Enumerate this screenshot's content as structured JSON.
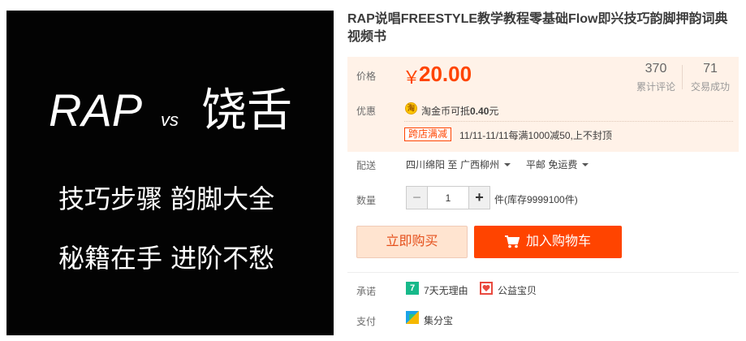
{
  "product_image": {
    "line1_left": "RAP",
    "line1_mid": "vs",
    "line1_right": "饶舌",
    "line2": "技巧步骤 韵脚大全",
    "line3": "秘籍在手 进阶不愁"
  },
  "title": "RAP说唱FREESTYLE教学教程零基础Flow即兴技巧韵脚押韵词典视频书",
  "price": {
    "label": "价格",
    "currency": "￥",
    "value": "20.00",
    "reviews_count": "370",
    "reviews_label": "累计评论",
    "sold_count": "71",
    "sold_label": "交易成功"
  },
  "promo": {
    "label": "优惠",
    "coin_icon_text": "淘",
    "coin_text_prefix": "淘金币可抵",
    "coin_text_amount": "0.40",
    "coin_text_suffix": "元",
    "cross_store_badge": "跨店满减",
    "cross_store_text": "11/11-11/11每满1000减50,上不封顶"
  },
  "shipping": {
    "label": "配送",
    "from": "四川绵阳 至",
    "to": "广西柳州",
    "fee": "平邮 免运费"
  },
  "quantity": {
    "label": "数量",
    "minus": "−",
    "value": "1",
    "plus": "+",
    "stock": "件(库存9999100件)"
  },
  "actions": {
    "buy_now": "立即购买",
    "add_to_cart": "加入购物车"
  },
  "promise": {
    "label": "承诺",
    "badge7": "7",
    "item1": "7天无理由",
    "item2": "公益宝贝"
  },
  "payment": {
    "label": "支付",
    "item1": "集分宝"
  },
  "colors": {
    "accent": "#ff4400",
    "panel_bg": "#fff2e8",
    "image_bg": "#030303"
  }
}
